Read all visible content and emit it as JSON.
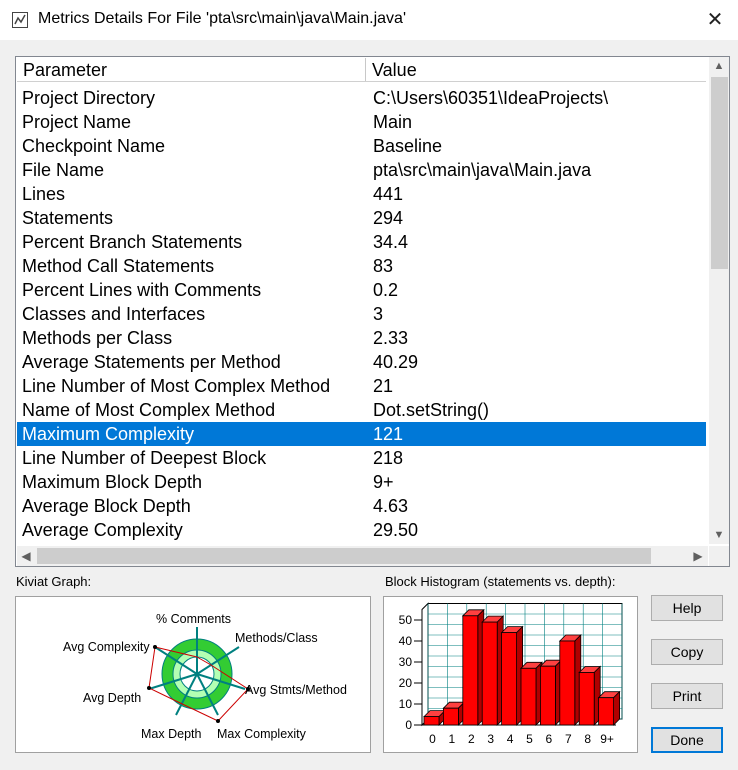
{
  "window": {
    "title": "Metrics Details For File 'pta\\src\\main\\java\\Main.java'",
    "close": "✕"
  },
  "table": {
    "headers": [
      "Parameter",
      "Value"
    ],
    "rows": [
      {
        "p": "Project Directory",
        "v": "C:\\Users\\60351\\IdeaProjects\\"
      },
      {
        "p": "Project Name",
        "v": "Main"
      },
      {
        "p": "Checkpoint Name",
        "v": "Baseline"
      },
      {
        "p": "File Name",
        "v": "pta\\src\\main\\java\\Main.java"
      },
      {
        "p": "Lines",
        "v": "441"
      },
      {
        "p": "Statements",
        "v": "294"
      },
      {
        "p": "Percent Branch Statements",
        "v": "34.4"
      },
      {
        "p": "Method Call Statements",
        "v": "83"
      },
      {
        "p": "Percent Lines with Comments",
        "v": "0.2"
      },
      {
        "p": "Classes and Interfaces",
        "v": "3"
      },
      {
        "p": "Methods per Class",
        "v": "2.33"
      },
      {
        "p": "Average Statements per Method",
        "v": "40.29"
      },
      {
        "p": "Line Number of Most Complex Method",
        "v": "21"
      },
      {
        "p": "Name of Most Complex Method",
        "v": "Dot.setString()"
      },
      {
        "p": "Maximum Complexity",
        "v": "121",
        "selected": true
      },
      {
        "p": "Line Number of Deepest Block",
        "v": "218"
      },
      {
        "p": "Maximum Block Depth",
        "v": "9+"
      },
      {
        "p": "Average Block Depth",
        "v": "4.63"
      },
      {
        "p": "Average Complexity",
        "v": "29.50"
      }
    ]
  },
  "kiviat": {
    "label": "Kiviat Graph:",
    "axes": [
      "% Comments",
      "Methods/Class",
      "Avg Stmts/Method",
      "Max Complexity",
      "Max Depth",
      "Avg Depth",
      "Avg Complexity"
    ]
  },
  "histogram": {
    "label": "Block Histogram (statements vs. depth):",
    "chart_data": {
      "type": "bar",
      "categories": [
        "0",
        "1",
        "2",
        "3",
        "4",
        "5",
        "6",
        "7",
        "8",
        "9+"
      ],
      "values": [
        4,
        8,
        52,
        49,
        44,
        27,
        28,
        40,
        25,
        13
      ],
      "yticks": [
        "0",
        "10",
        "20",
        "30",
        "40",
        "50"
      ],
      "ylim": [
        0,
        55
      ],
      "grid": true,
      "bar_color": "#ff0000"
    }
  },
  "buttons": {
    "help": "Help",
    "copy": "Copy",
    "print": "Print",
    "done": "Done"
  },
  "colors": {
    "selection": "#0078d7",
    "kiviat_ring_outer": "#33cc33",
    "kiviat_ring_inner": "#b3ffb3",
    "kiviat_spokes": "#008080",
    "kiviat_polygon": "#cc0000"
  }
}
